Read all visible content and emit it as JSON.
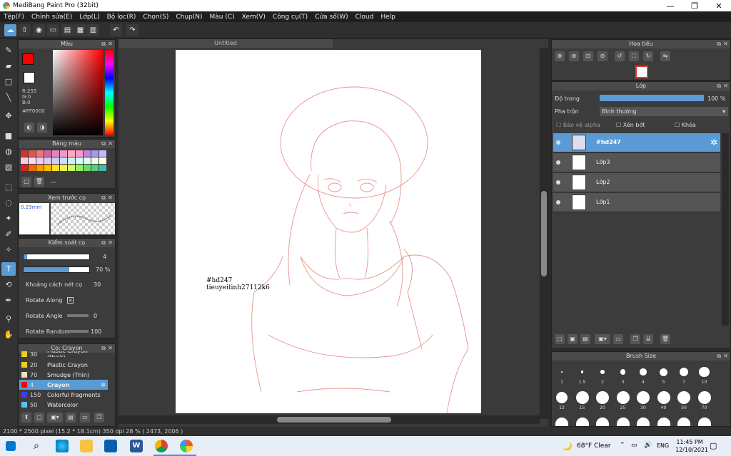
{
  "window": {
    "title": "MediBang Paint Pro (32bit)"
  },
  "menu": [
    "Tệp(F)",
    "Chỉnh sửa(E)",
    "Lớp(L)",
    "Bộ lọc(R)",
    "Chọn(S)",
    "Chụp(N)",
    "Màu (C)",
    "Xem(V)",
    "Công cụ(T)",
    "Cửa sổ(W)",
    "Cloud",
    "Help"
  ],
  "canvas": {
    "tab_title": "Untitled",
    "watermark_line1": "#hd247",
    "watermark_line2": "tieuyeitinh27112k6"
  },
  "color_panel": {
    "title": "Màu",
    "rgb_r": "R:255",
    "rgb_g": "G:0",
    "rgb_b": "B:0",
    "hex": "#FF0000",
    "fg_color": "#ff0000",
    "bg_color": "#ffffff"
  },
  "palette_panel": {
    "title": "Bảng màu",
    "status": "---"
  },
  "preview_panel": {
    "title": "Xem trước cọ",
    "size": "0.29mm"
  },
  "brush_control": {
    "title": "Kiểm soát cọ",
    "size_value": "4",
    "size_fraction": 0.05,
    "opacity_value": "70 %",
    "opacity_fraction": 0.7,
    "rows": [
      {
        "label": "Khoảng cách nét cọ",
        "value": "30"
      },
      {
        "label": "Rotate Along",
        "value": ""
      },
      {
        "label": "Rotate Angle",
        "value": "0"
      },
      {
        "label": "Rotate Random",
        "value": "100"
      }
    ]
  },
  "brush_list": {
    "title": "Cọ: Crayon",
    "items": [
      {
        "size": "30",
        "name": "Plastic Crayon (thick)",
        "color": "#e8d020"
      },
      {
        "size": "20",
        "name": "Plastic Crayon",
        "color": "#e8d020"
      },
      {
        "size": "70",
        "name": "Smudge (Thin)",
        "color": "#f0e0c0"
      },
      {
        "size": "4",
        "name": "Crayon",
        "color": "#ff0000"
      },
      {
        "size": "150",
        "name": "Colorful fragments",
        "color": "#4040e0"
      },
      {
        "size": "50",
        "name": "Watercolor",
        "color": "#60c0f0"
      }
    ]
  },
  "navigator": {
    "title": "Hoa tiêu"
  },
  "layer_panel": {
    "title": "Lớp",
    "opacity_label": "Độ trong",
    "opacity_value": "100 %",
    "opacity_fraction": 1.0,
    "blend_label": "Pha trộn",
    "blend_value": "Bình thường",
    "protect_alpha": "Bảo vệ alpha",
    "clipping": "Xén bớt",
    "lock": "Khóa",
    "layers": [
      {
        "name": "#hd247",
        "selected": true
      },
      {
        "name": "Lớp3",
        "selected": false
      },
      {
        "name": "Lớp2",
        "selected": false
      },
      {
        "name": "Lớp1",
        "selected": false
      }
    ]
  },
  "brush_size_panel": {
    "title": "Brush Size",
    "sizes": [
      "1",
      "1.5",
      "2",
      "3",
      "4",
      "5",
      "7",
      "10",
      "12",
      "15",
      "20",
      "25",
      "30",
      "40",
      "50",
      "70"
    ]
  },
  "status": {
    "text": "2100 * 2500 pixel  (15.2 * 18.1cm)  350 dpi  28 %  ( 2473, 2006 )"
  },
  "taskbar": {
    "weather": "68°F  Clear",
    "lang": "ENG",
    "time": "11:45 PM",
    "date": "12/10/2021"
  }
}
